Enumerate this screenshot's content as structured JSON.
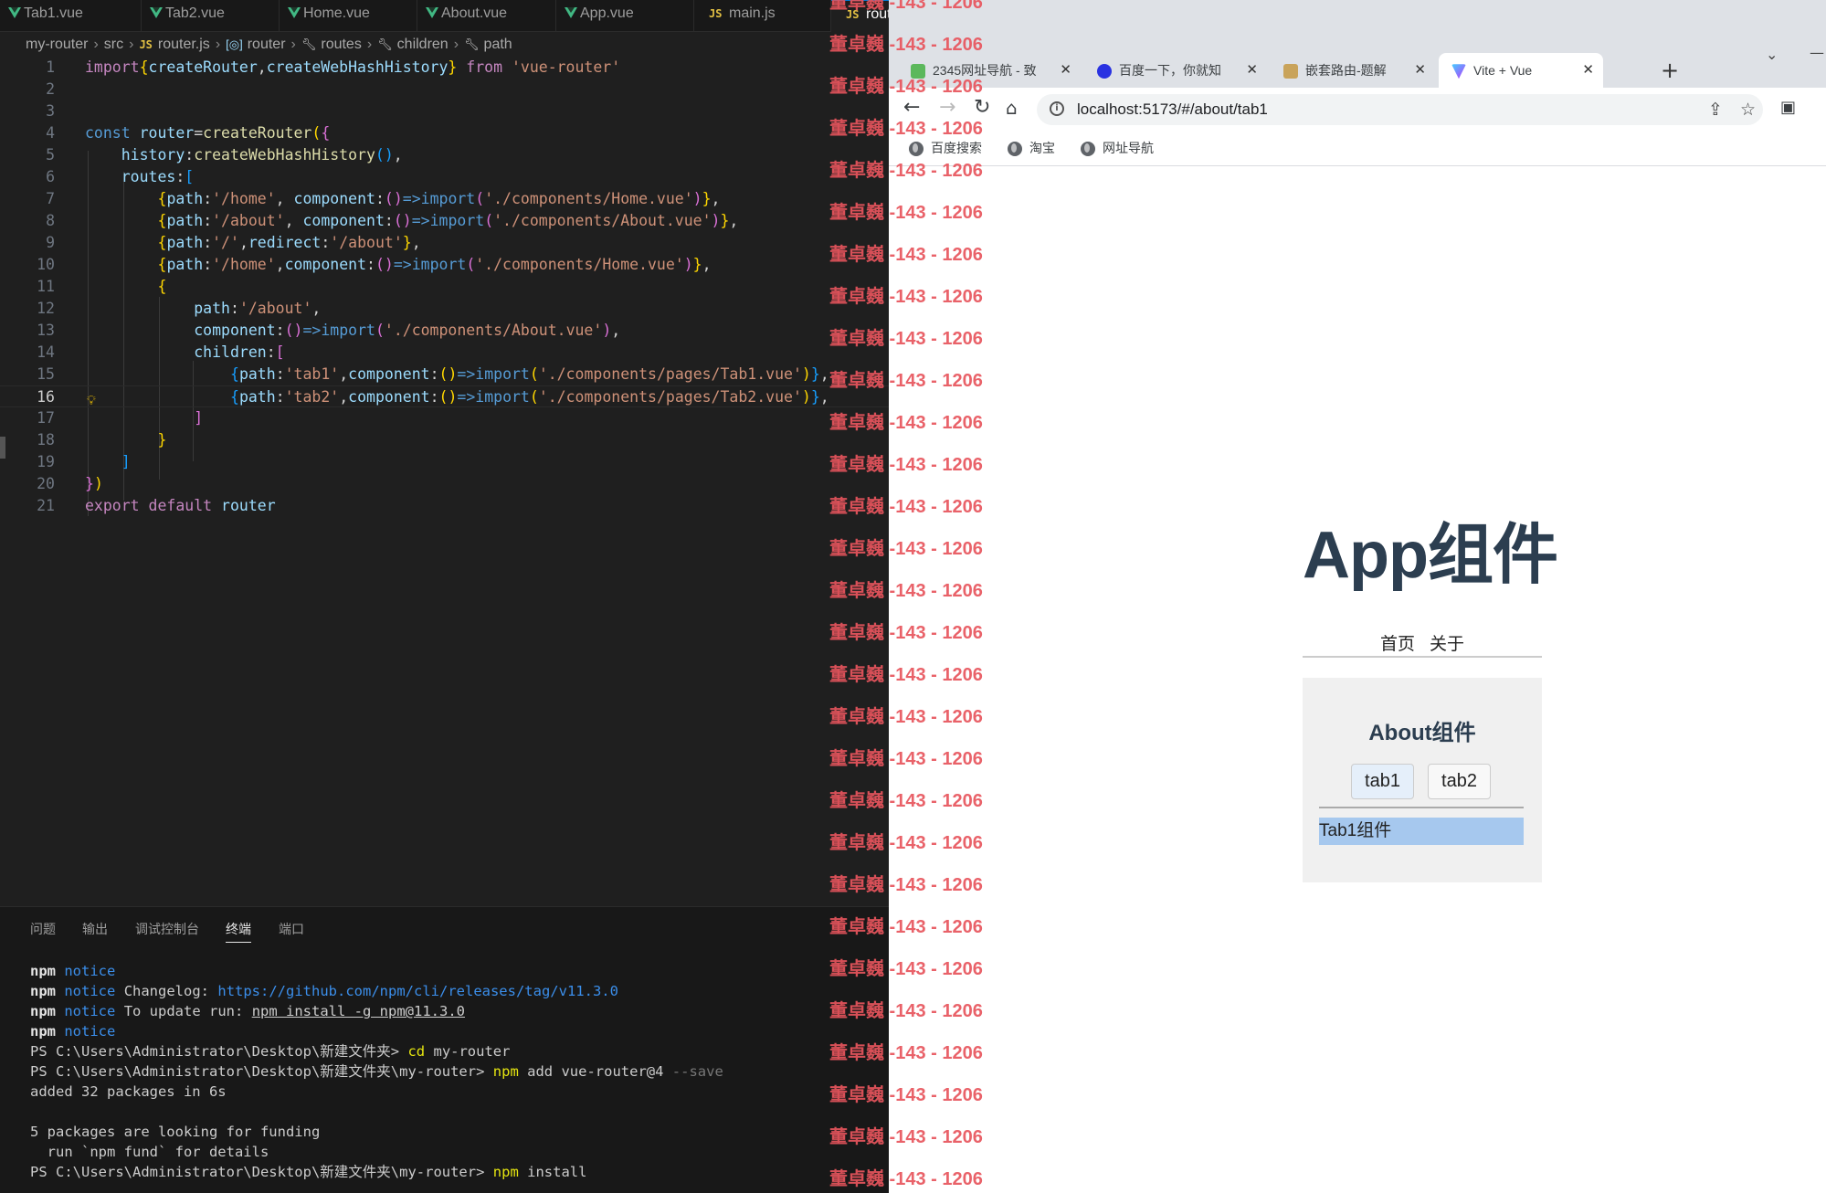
{
  "editor": {
    "tabs": [
      {
        "label": "Tab1.vue",
        "icon": "vue-file-icon"
      },
      {
        "label": "Tab2.vue",
        "icon": "vue-file-icon"
      },
      {
        "label": "Home.vue",
        "icon": "vue-file-icon"
      },
      {
        "label": "About.vue",
        "icon": "vue-file-icon"
      },
      {
        "label": "App.vue",
        "icon": "vue-file-icon"
      },
      {
        "label": "main.js",
        "icon": "js-file-icon"
      },
      {
        "label": "router.js",
        "icon": "js-file-icon",
        "active": true
      }
    ],
    "js_badge": "JS",
    "close_glyph": "✕",
    "breadcrumb": [
      "my-router",
      "src",
      "router.js",
      "router",
      "routes",
      "children",
      "path"
    ],
    "current_line": 16,
    "code_lines": [
      "import{createRouter,createWebHashHistory} from 'vue-router'",
      "",
      "",
      "const router=createRouter({",
      "    history:createWebHashHistory(),",
      "    routes:[",
      "        {path:'/home', component:()=>import('./components/Home.vue')},",
      "        {path:'/about', component:()=>import('./components/About.vue')},",
      "        {path:'/',redirect:'/about'},",
      "        {path:'/home',component:()=>import('./components/Home.vue')},",
      "        {",
      "            path:'/about',",
      "            component:()=>import('./components/About.vue'),",
      "            children:[",
      "                {path:'tab1',component:()=>import('./components/pages/Tab1.vue')},",
      "                {path:'tab2',component:()=>import('./components/pages/Tab2.vue')},",
      "            ]",
      "        }",
      "    ]",
      "})",
      "export default router"
    ]
  },
  "panel": {
    "tabs": [
      "问题",
      "输出",
      "调试控制台",
      "终端",
      "端口"
    ],
    "active_tab": "终端",
    "terminal": {
      "npm": "npm",
      "notice": "notice",
      "changelog_label": "Changelog:",
      "changelog_url": "https://github.com/npm/cli/releases/tag/v11.3.0",
      "update_label": "To update run:",
      "update_cmd": "npm install -g npm@11.3.0",
      "prompt1": "PS C:\\Users\\Administrator\\Desktop\\新建文件夹>",
      "cmd1": "cd",
      "cmd1_arg": "my-router",
      "prompt2": "PS C:\\Users\\Administrator\\Desktop\\新建文件夹\\my-router>",
      "cmd2_args": "add vue-router@4",
      "cmd2_flag": "--save",
      "added": "added 32 packages in 6s",
      "funding1": "5 packages are looking for funding",
      "funding2": "  run `npm fund` for details",
      "cmd3_args": "install"
    }
  },
  "watermark": {
    "name": "董卓巍",
    "code": "-143 - 1206",
    "color": "#e8555d"
  },
  "browser": {
    "tabs": [
      {
        "title": "2345网址导航 - 致",
        "icon": "2345-favicon"
      },
      {
        "title": "百度一下，你就知",
        "icon": "baidu-favicon"
      },
      {
        "title": "嵌套路由-题解",
        "icon": "image-favicon"
      },
      {
        "title": "Vite + Vue",
        "icon": "vite-favicon",
        "active": true
      }
    ],
    "close_glyph": "✕",
    "new_tab_glyph": "+",
    "url": "localhost:5173/#/about/tab1",
    "bookmarks": [
      "百度搜索",
      "淘宝",
      "网址导航"
    ]
  },
  "app": {
    "title": "App组件",
    "nav": [
      "首页",
      "关于"
    ],
    "about_title": "About组件",
    "tab_buttons": [
      "tab1",
      "tab2"
    ],
    "selected_tab": "tab1",
    "tab_content": "Tab1组件",
    "colors": {
      "title": "#2c3e50",
      "selection": "#a6c8ee"
    }
  }
}
